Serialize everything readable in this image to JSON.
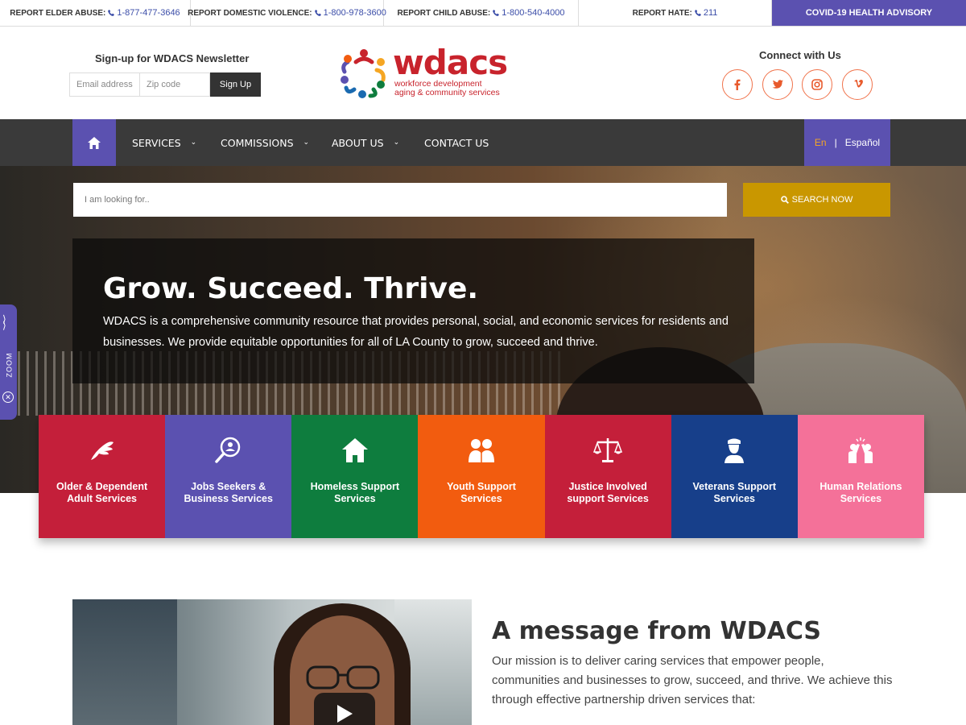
{
  "alerts": [
    {
      "label": "REPORT ELDER ABUSE:",
      "phone": "1-877-477-3646"
    },
    {
      "label": "REPORT DOMESTIC VIOLENCE:",
      "phone": "1-800-978-3600"
    },
    {
      "label": "REPORT CHILD ABUSE:",
      "phone": "1-800-540-4000"
    },
    {
      "label": "REPORT HATE:",
      "phone": "211"
    }
  ],
  "covid_label": "COVID-19 HEALTH ADVISORY",
  "newsletter": {
    "title": "Sign-up for WDACS Newsletter",
    "email_placeholder": "Email address",
    "zip_placeholder": "Zip code",
    "button": "Sign Up"
  },
  "logo": {
    "word": "wdacs",
    "line1": "workforce development",
    "line2": "aging & community services"
  },
  "connect": {
    "title": "Connect with Us",
    "icons": [
      "facebook-icon",
      "twitter-icon",
      "instagram-icon",
      "vimeo-icon"
    ]
  },
  "nav": {
    "items": [
      "SERVICES",
      "COMMISSIONS",
      "ABOUT US",
      "CONTACT US"
    ],
    "lang_en": "En",
    "lang_sep": "|",
    "lang_es": "Español"
  },
  "search": {
    "placeholder": "I am looking for..",
    "button": "SEARCH NOW"
  },
  "hero": {
    "title": "Grow. Succeed. Thrive.",
    "text": "WDACS is a comprehensive community resource that provides personal, social, and economic services for residents and businesses. We provide equitable opportunities for all of LA County to grow, succeed and thrive."
  },
  "zoom_label": "ZOOM",
  "tiles": [
    {
      "line1": "Older & Dependent",
      "line2": "Adult Services",
      "color": "#c41f3a",
      "icon": "helping-hands-icon"
    },
    {
      "line1": "Jobs Seekers &",
      "line2": "Business Services",
      "color": "#5b51b0",
      "icon": "job-search-icon"
    },
    {
      "line1": "Homeless Support",
      "line2": "Services",
      "color": "#0e7d3e",
      "icon": "house-icon"
    },
    {
      "line1": "Youth Support",
      "line2": "Services",
      "color": "#f25c0f",
      "icon": "youth-icon"
    },
    {
      "line1": "Justice Involved",
      "line2": "support Services",
      "color": "#c41f3a",
      "icon": "scales-icon"
    },
    {
      "line1": "Veterans Support",
      "line2": "Services",
      "color": "#173f8a",
      "icon": "veteran-icon"
    },
    {
      "line1": "Human Relations",
      "line2": "Services",
      "color": "#f47199",
      "icon": "high-five-icon"
    }
  ],
  "message": {
    "title": "A message from WDACS",
    "text": "Our mission is to deliver caring services that empower people, communities and businesses to grow, succeed, and thrive. We achieve this through effective partnership driven services that:"
  }
}
